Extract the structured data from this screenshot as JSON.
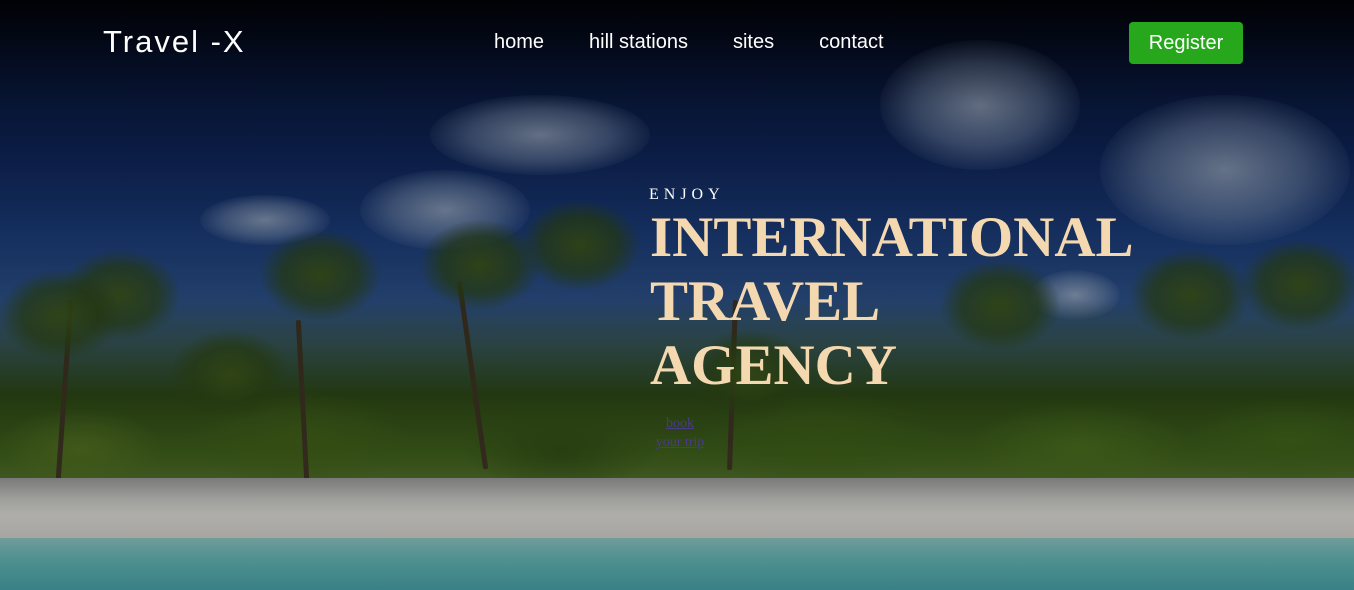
{
  "brand": "Travel -X",
  "nav": {
    "items": [
      "home",
      "hill stations",
      "sites",
      "contact"
    ]
  },
  "register_label": "Register",
  "hero": {
    "eyebrow": "ENJOY",
    "headline_line1": "INTERNATIONAL",
    "headline_line2": "TRAVEL",
    "headline_line3": "AGENCY",
    "book_link_line1": "book",
    "book_link_line2": "your trip"
  },
  "colors": {
    "register_bg": "#27a71c",
    "headline": "#f4d9b0",
    "link": "#4b3a8c"
  }
}
